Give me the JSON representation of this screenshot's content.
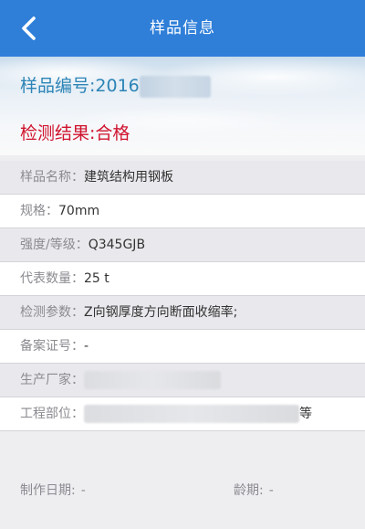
{
  "header": {
    "title": "样品信息",
    "back_icon": "chevron-left-icon"
  },
  "sample": {
    "number_label": "样品编号:",
    "number_value": "2016"
  },
  "result": {
    "label": "检测结果:",
    "value": "合格"
  },
  "rows": [
    {
      "label": "样品名称：",
      "value": "建筑结构用钢板"
    },
    {
      "label": "规格：",
      "value": "70mm"
    },
    {
      "label": "强度/等级：",
      "value": "Q345GJB"
    },
    {
      "label": "代表数量：",
      "value": "25 t"
    },
    {
      "label": "检测参数：",
      "value": "Z向钢厚度方向断面收缩率;"
    },
    {
      "label": "备案证号：",
      "value": "-"
    },
    {
      "label": "生产厂家：",
      "value": ""
    },
    {
      "label": "工程部位：",
      "value": "等"
    }
  ],
  "footer": {
    "date_label": "制作日期:",
    "date_value": "-",
    "age_label": "龄期:",
    "age_value": "-"
  },
  "colors": {
    "header_bg": "#2f7fd9",
    "sample_no": "#2b84b6",
    "result_text": "#d0132e"
  }
}
